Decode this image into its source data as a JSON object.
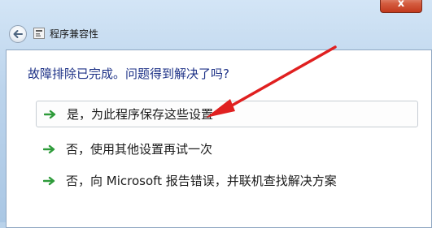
{
  "window": {
    "title": "程序兼容性",
    "close_label": "x",
    "back_icon": "back-arrow-icon",
    "title_icon": "troubleshooter-icon",
    "close_color": "#c8452a"
  },
  "main": {
    "heading": "故障排除已完成。问题得到解决了吗?",
    "options": [
      {
        "label": "是，为此程序保存这些设置",
        "icon": "green-arrow-icon"
      },
      {
        "label": "否，使用其他设置再试一次",
        "icon": "green-arrow-icon"
      },
      {
        "label": "否，向 Microsoft 报告错误，并联机查找解决方案",
        "icon": "green-arrow-icon"
      }
    ],
    "heading_color": "#1e3287",
    "option_arrow_color": "#2e9b3a"
  },
  "annotation": {
    "arrow_color": "#e02020"
  }
}
